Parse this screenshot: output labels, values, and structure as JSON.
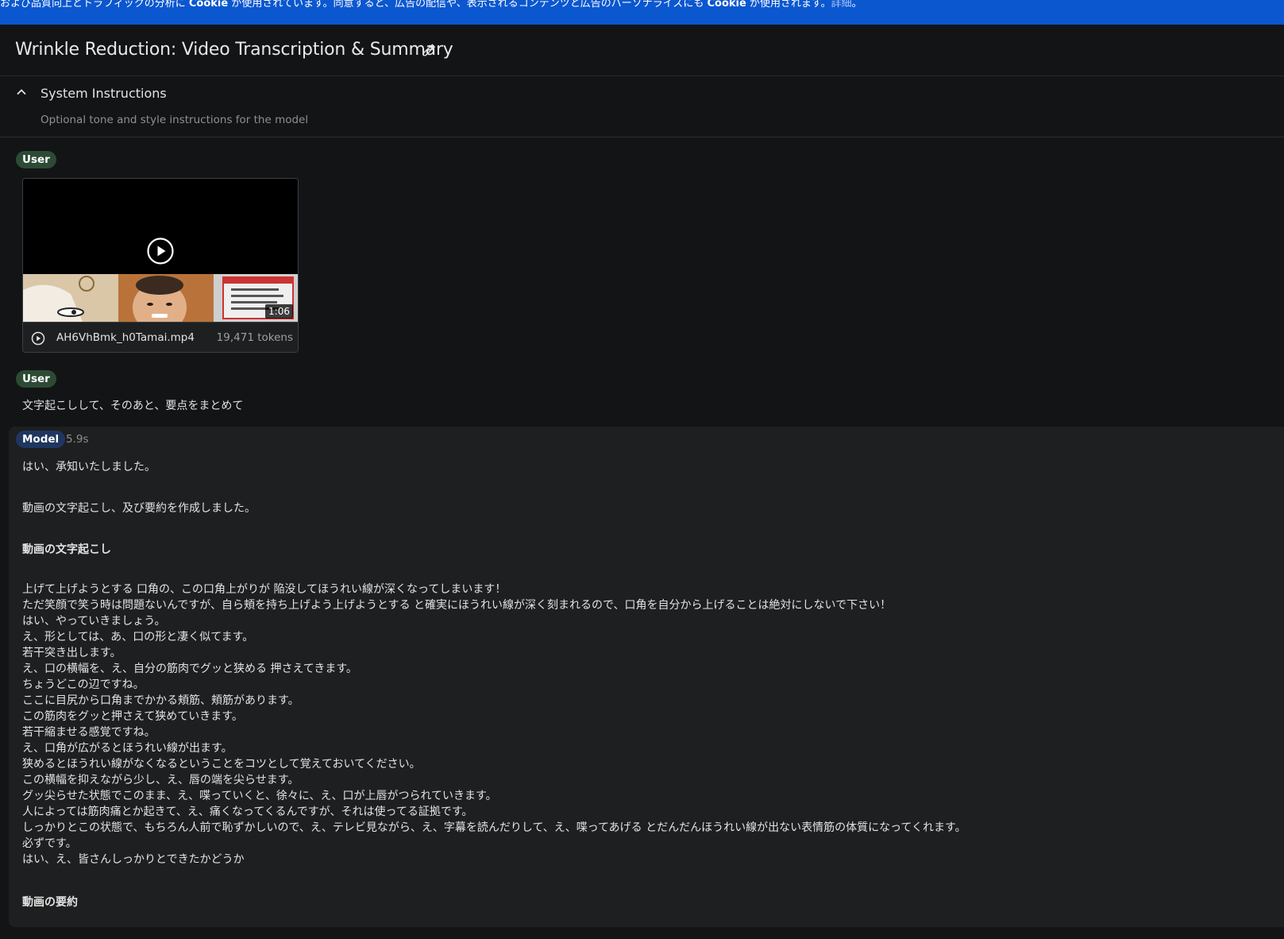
{
  "cookie_banner": {
    "text_part1": "および品質向上とトラフィックの分析に ",
    "cookie_word_1": "Cookie",
    "text_part2": " が使用されています。同意すると、広告の配信や、表示されるコンテンツと広告のパーソナライズにも ",
    "cookie_word_2": "Cookie",
    "text_part3": " が使用されます。",
    "link": "詳細",
    "end": "。"
  },
  "header": {
    "title": "Wrinkle Reduction: Video Transcription & Summary",
    "edit_icon": "pencil-icon"
  },
  "system_instructions": {
    "title": "System Instructions",
    "placeholder": "Optional tone and style instructions for the model"
  },
  "turns": {
    "user_label": "User",
    "model_label": "Model",
    "model_time": "5.9s"
  },
  "video": {
    "duration": "1:06",
    "file_name": "AH6VhBmk_h0Tamai.mp4",
    "tokens": "19,471 tokens"
  },
  "user_prompt": "文字起こしして、そのあと、要点をまとめて",
  "response": {
    "intro": "はい、承知いたしました。",
    "intro2": "動画の文字起こし、及び要約を作成しました。",
    "section1": "動画の文字起こし",
    "transcript": [
      "上げて上げようとする 口角の、この口角上がりが 陥没してほうれい線が深くなってしまいます！",
      "ただ笑顔で笑う時は問題ないんですが、自ら頬を持ち上げよう上げようとする と確実にほうれい線が深く刻まれるので、口角を自分から上げることは絶対にしないで下さい！",
      "はい、やっていきましょう。",
      "え、形としては、あ、口の形と凄く似てます。",
      "若干突き出します。",
      "え、口の横幅を、え、自分の筋肉でグッと狭める 押さえてきます。",
      "ちょうどこの辺ですね。",
      "ここに目尻から口角までかかる頬筋、頬筋があります。",
      "この筋肉をグッと押さえて狭めていきます。",
      "若干縮ませる感覚ですね。",
      "え、口角が広がるとほうれい線が出ます。",
      "狭めるとほうれい線がなくなるということをコツとして覚えておいてください。",
      "この横幅を抑えながら少し、え、唇の端を尖らせます。",
      "グッ尖らせた状態でこのまま、え、喋っていくと、徐々に、え、口が上唇がつられていきます。",
      "人によっては筋肉痛とか起きて、え、痛くなってくるんですが、それは使ってる証拠です。",
      "しっかりとこの状態で、もちろん人前で恥ずかしいので、え、テレビ見ながら、え、字幕を読んだりして、え、喋ってあげる とだんだんほうれい線が出ない表情筋の体質になってくれます。",
      "必ずです。",
      "はい、え、皆さんしっかりとできたかどうか"
    ],
    "section2": "動画の要約"
  }
}
